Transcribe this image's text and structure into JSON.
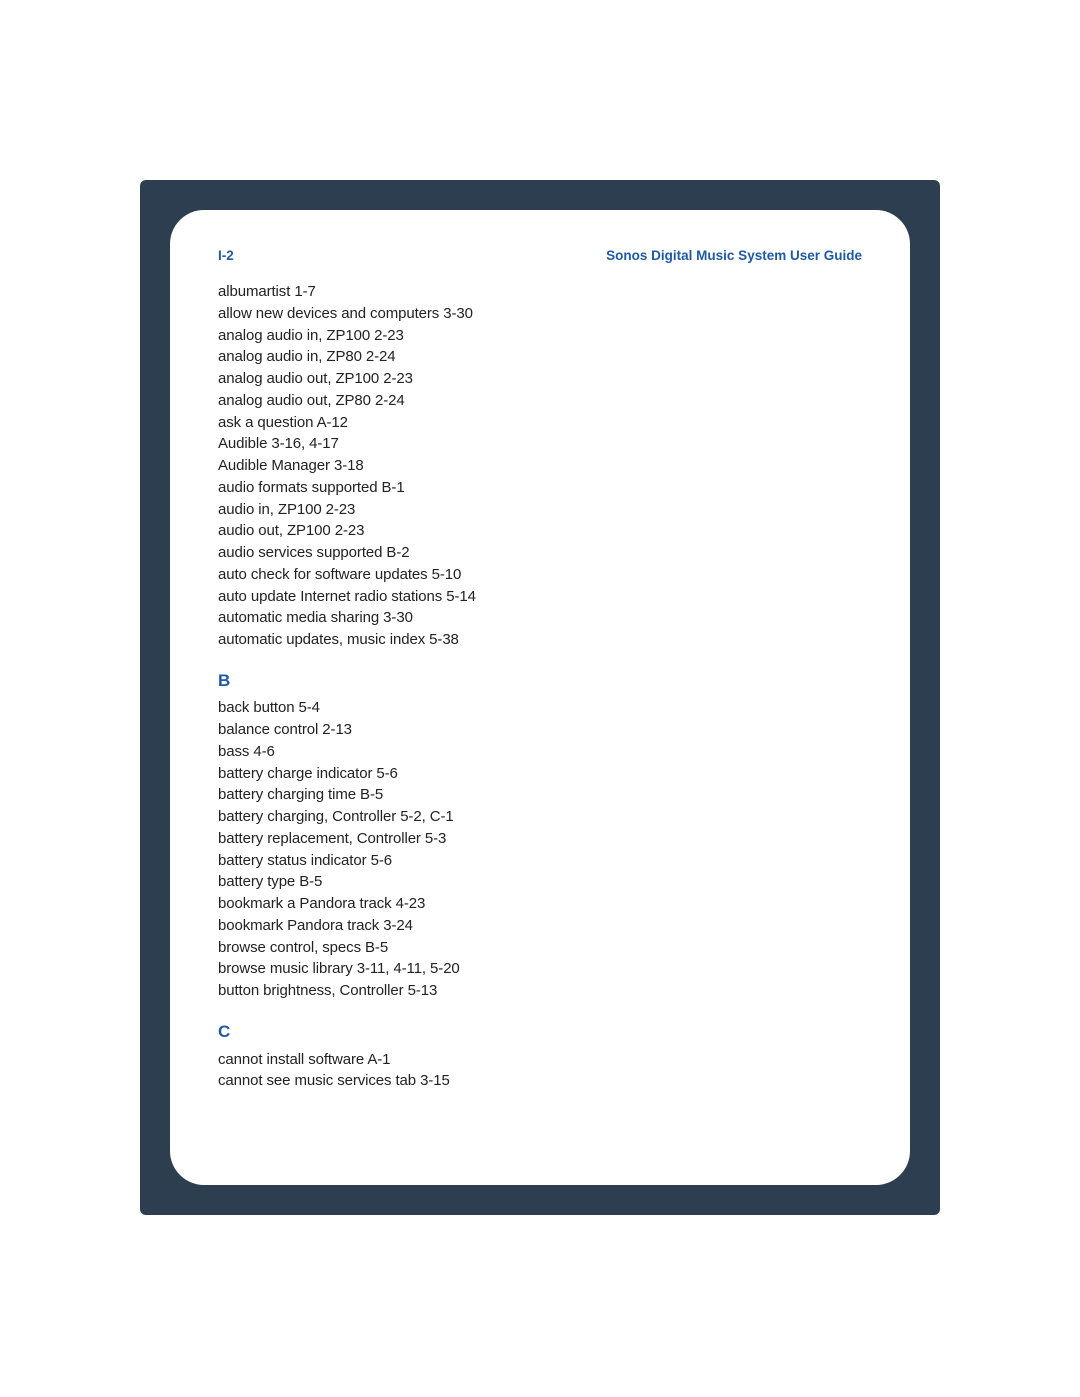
{
  "header": {
    "page_number": "I-2",
    "title": "Sonos Digital Music System User Guide"
  },
  "sections": [
    {
      "heading": null,
      "entries": [
        "albumartist 1-7",
        "allow new devices and computers 3-30",
        "analog audio in, ZP100 2-23",
        "analog audio in, ZP80 2-24",
        "analog audio out, ZP100 2-23",
        "analog audio out, ZP80 2-24",
        "ask a question A-12",
        "Audible 3-16, 4-17",
        "Audible Manager 3-18",
        "audio formats supported B-1",
        "audio in, ZP100 2-23",
        "audio out, ZP100 2-23",
        "audio services supported B-2",
        "auto check for software updates 5-10",
        "auto update Internet radio stations 5-14",
        "automatic media sharing 3-30",
        "automatic updates, music index 5-38"
      ]
    },
    {
      "heading": "B",
      "entries": [
        "back button 5-4",
        "balance control 2-13",
        "bass 4-6",
        "battery charge indicator 5-6",
        "battery charging time B-5",
        "battery charging, Controller 5-2, C-1",
        "battery replacement, Controller 5-3",
        "battery status indicator 5-6",
        "battery type B-5",
        "bookmark a Pandora track 4-23",
        "bookmark Pandora track 3-24",
        "browse control, specs B-5",
        "browse music library 3-11, 4-11, 5-20",
        "button brightness, Controller 5-13"
      ]
    },
    {
      "heading": "C",
      "entries": [
        "cannot install software A-1",
        "cannot see music services tab 3-15"
      ]
    }
  ]
}
